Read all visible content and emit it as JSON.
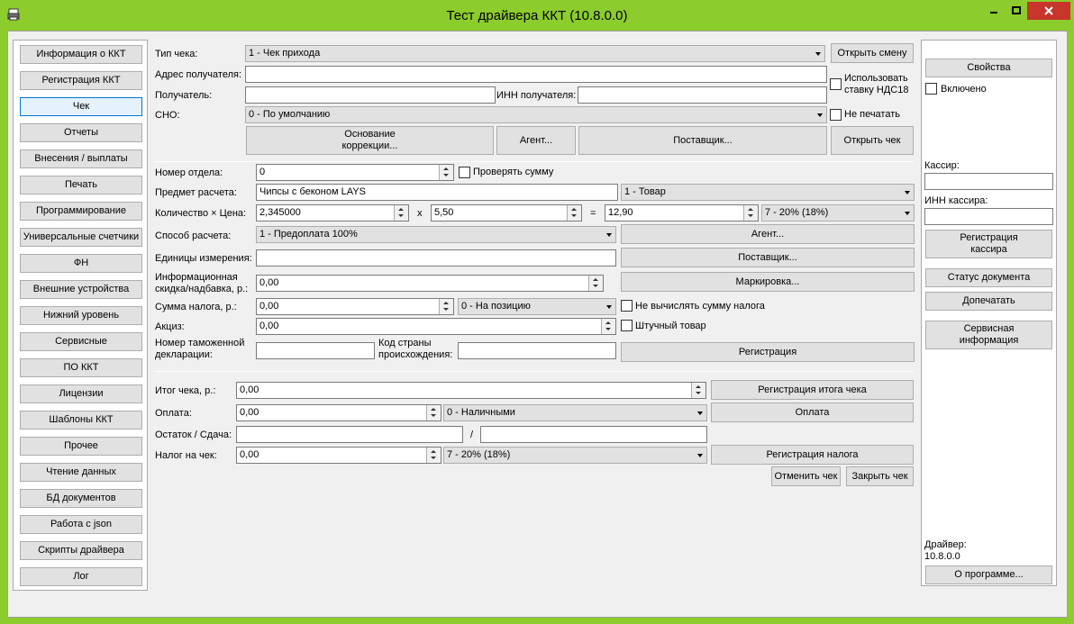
{
  "window": {
    "title": "Тест драйвера ККТ (10.8.0.0)"
  },
  "sidebar": {
    "items": [
      {
        "label": "Информация о ККТ"
      },
      {
        "label": "Регистрация ККТ"
      },
      {
        "label": "Чек",
        "active": true
      },
      {
        "label": "Отчеты"
      },
      {
        "label": "Внесения / выплаты"
      },
      {
        "label": "Печать"
      },
      {
        "label": "Программирование"
      },
      {
        "label": "Универсальные счетчики"
      },
      {
        "label": "ФН"
      },
      {
        "label": "Внешние устройства"
      },
      {
        "label": "Нижний уровень"
      },
      {
        "label": "Сервисные"
      },
      {
        "label": "ПО ККТ"
      },
      {
        "label": "Лицензии"
      },
      {
        "label": "Шаблоны ККТ"
      },
      {
        "label": "Прочее"
      },
      {
        "label": "Чтение данных"
      },
      {
        "label": "БД документов"
      },
      {
        "label": "Работа с json"
      },
      {
        "label": "Скрипты драйвера"
      },
      {
        "label": "Лог"
      }
    ]
  },
  "receipt": {
    "type_label": "Тип чека:",
    "type_value": "1 - Чек прихода",
    "open_shift": "Открыть смену",
    "address_label": "Адрес получателя:",
    "address_value": "",
    "use_vat18": "Использовать ставку НДС18",
    "recipient_label": "Получатель:",
    "recipient_value": "",
    "inn_recipient_label": "ИНН получателя:",
    "inn_recipient_value": "",
    "sno_label": "СНО:",
    "sno_value": "0 - По умолчанию",
    "no_print": "Не печатать",
    "correction_basis": "Основание коррекции...",
    "agent": "Агент...",
    "supplier": "Поставщик...",
    "open_receipt": "Открыть чек"
  },
  "position": {
    "dept_label": "Номер отдела:",
    "dept_value": "0",
    "check_sum": "Проверять сумму",
    "subject_label": "Предмет расчета:",
    "subject_value": "Чипсы с беконом LAYS",
    "subject_type": "1 - Товар",
    "qty_price_label": "Количество × Цена:",
    "qty_value": "2,345000",
    "x_sign": "x",
    "price_value": "5,50",
    "eq_sign": "=",
    "total_value": "12,90",
    "vat_value": "7 - 20% (18%)",
    "method_label": "Способ расчета:",
    "method_value": "1 - Предоплата 100%",
    "agent": "Агент...",
    "unit_label": "Единицы измерения:",
    "unit_value": "",
    "supplier": "Поставщик...",
    "discount_label": "Информационная скидка/надбавка, р.:",
    "discount_value": "0,00",
    "marking": "Маркировка...",
    "tax_sum_label": "Сумма налога, р.:",
    "tax_sum_value": "0,00",
    "tax_mode": "0 - На позицию",
    "no_calc_tax": "Не вычислять сумму налога",
    "excise_label": "Акциз:",
    "excise_value": "0,00",
    "piece_goods": "Штучный товар",
    "customs_label": "Номер таможенной декларации:",
    "customs_value": "",
    "country_label": "Код страны происхождения:",
    "country_value": "",
    "register": "Регистрация"
  },
  "totals": {
    "total_label": "Итог чека, р.:",
    "total_value": "0,00",
    "register_total": "Регистрация итога чека",
    "payment_label": "Оплата:",
    "payment_value": "0,00",
    "payment_type": "0 - Наличными",
    "pay": "Оплата",
    "change_label": "Остаток / Сдача:",
    "change_rest": "",
    "slash": "/",
    "change_value": "",
    "tax_label": "Налог на чек:",
    "tax_value": "0,00",
    "tax_type": "7 - 20% (18%)",
    "register_tax": "Регистрация налога",
    "cancel": "Отменить чек",
    "close": "Закрыть чек"
  },
  "right": {
    "properties": "Свойства",
    "enabled": "Включено",
    "cashier_label": "Кассир:",
    "cashier_value": "",
    "cashier_inn_label": "ИНН кассира:",
    "cashier_inn_value": "",
    "register_cashier": "Регистрация кассира",
    "doc_status": "Статус документа",
    "reprint": "Допечатать",
    "service_info": "Сервисная информация",
    "driver_label": "Драйвер:",
    "driver_version": "10.8.0.0",
    "about": "О программе..."
  }
}
